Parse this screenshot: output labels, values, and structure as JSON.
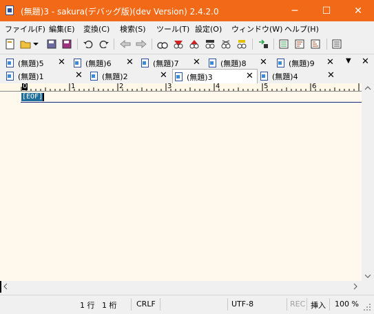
{
  "window": {
    "title": "(無題)3 - sakura(デバッグ版)(dev Version) 2.4.2.0",
    "minimize": "─",
    "maximize": "☐",
    "close": "✕"
  },
  "menu": [
    "ファイル(F)",
    "編集(E)",
    "変換(C)",
    "検索(S)",
    "ツール(T)",
    "設定(O)",
    "ウィンドウ(W)",
    "ヘルプ(H)"
  ],
  "toolbar_icons": [
    "new-file-icon",
    "open-file-icon",
    "dropdown-arrow-icon",
    "save-icon",
    "save-all-icon",
    "undo-icon",
    "redo-icon",
    "back-icon",
    "forward-icon",
    "search-prev-icon",
    "search-next-icon",
    "search-icon",
    "grep-icon",
    "replace-icon",
    "bookmark-icon",
    "compare-icon",
    "outline-icon",
    "sort-icon",
    "window-list-icon"
  ],
  "tabs_row1": [
    {
      "label": "(無題)5",
      "close": "✕"
    },
    {
      "label": "(無題)6",
      "close": "✕"
    },
    {
      "label": "(無題)7",
      "close": "✕"
    },
    {
      "label": "(無題)8",
      "close": "✕"
    },
    {
      "label": "(無題)9",
      "close": "✕"
    }
  ],
  "tabs_row2": [
    {
      "label": "(無題)1",
      "close": "✕"
    },
    {
      "label": "(無題)2",
      "close": "✕"
    },
    {
      "label": "(無題)3",
      "close": "✕"
    },
    {
      "label": "(無題)4",
      "close": "✕"
    }
  ],
  "tab_menu": "▼",
  "tab_close_all": "✕",
  "ruler": {
    "cursor": "0",
    "numbers": [
      "1",
      "2",
      "3",
      "4",
      "5",
      "6"
    ]
  },
  "editor": {
    "eof": "[EOF]"
  },
  "status": {
    "line": "1 行",
    "col": "1 桁",
    "eol": "CRLF",
    "encoding": "UTF-8",
    "rec": "REC",
    "mode": "挿入",
    "zoom": "100 %"
  },
  "colors": {
    "titlebar": "#f26a17",
    "editor_bg": "#fff8ec",
    "eof_bg": "#1e6e9a"
  }
}
